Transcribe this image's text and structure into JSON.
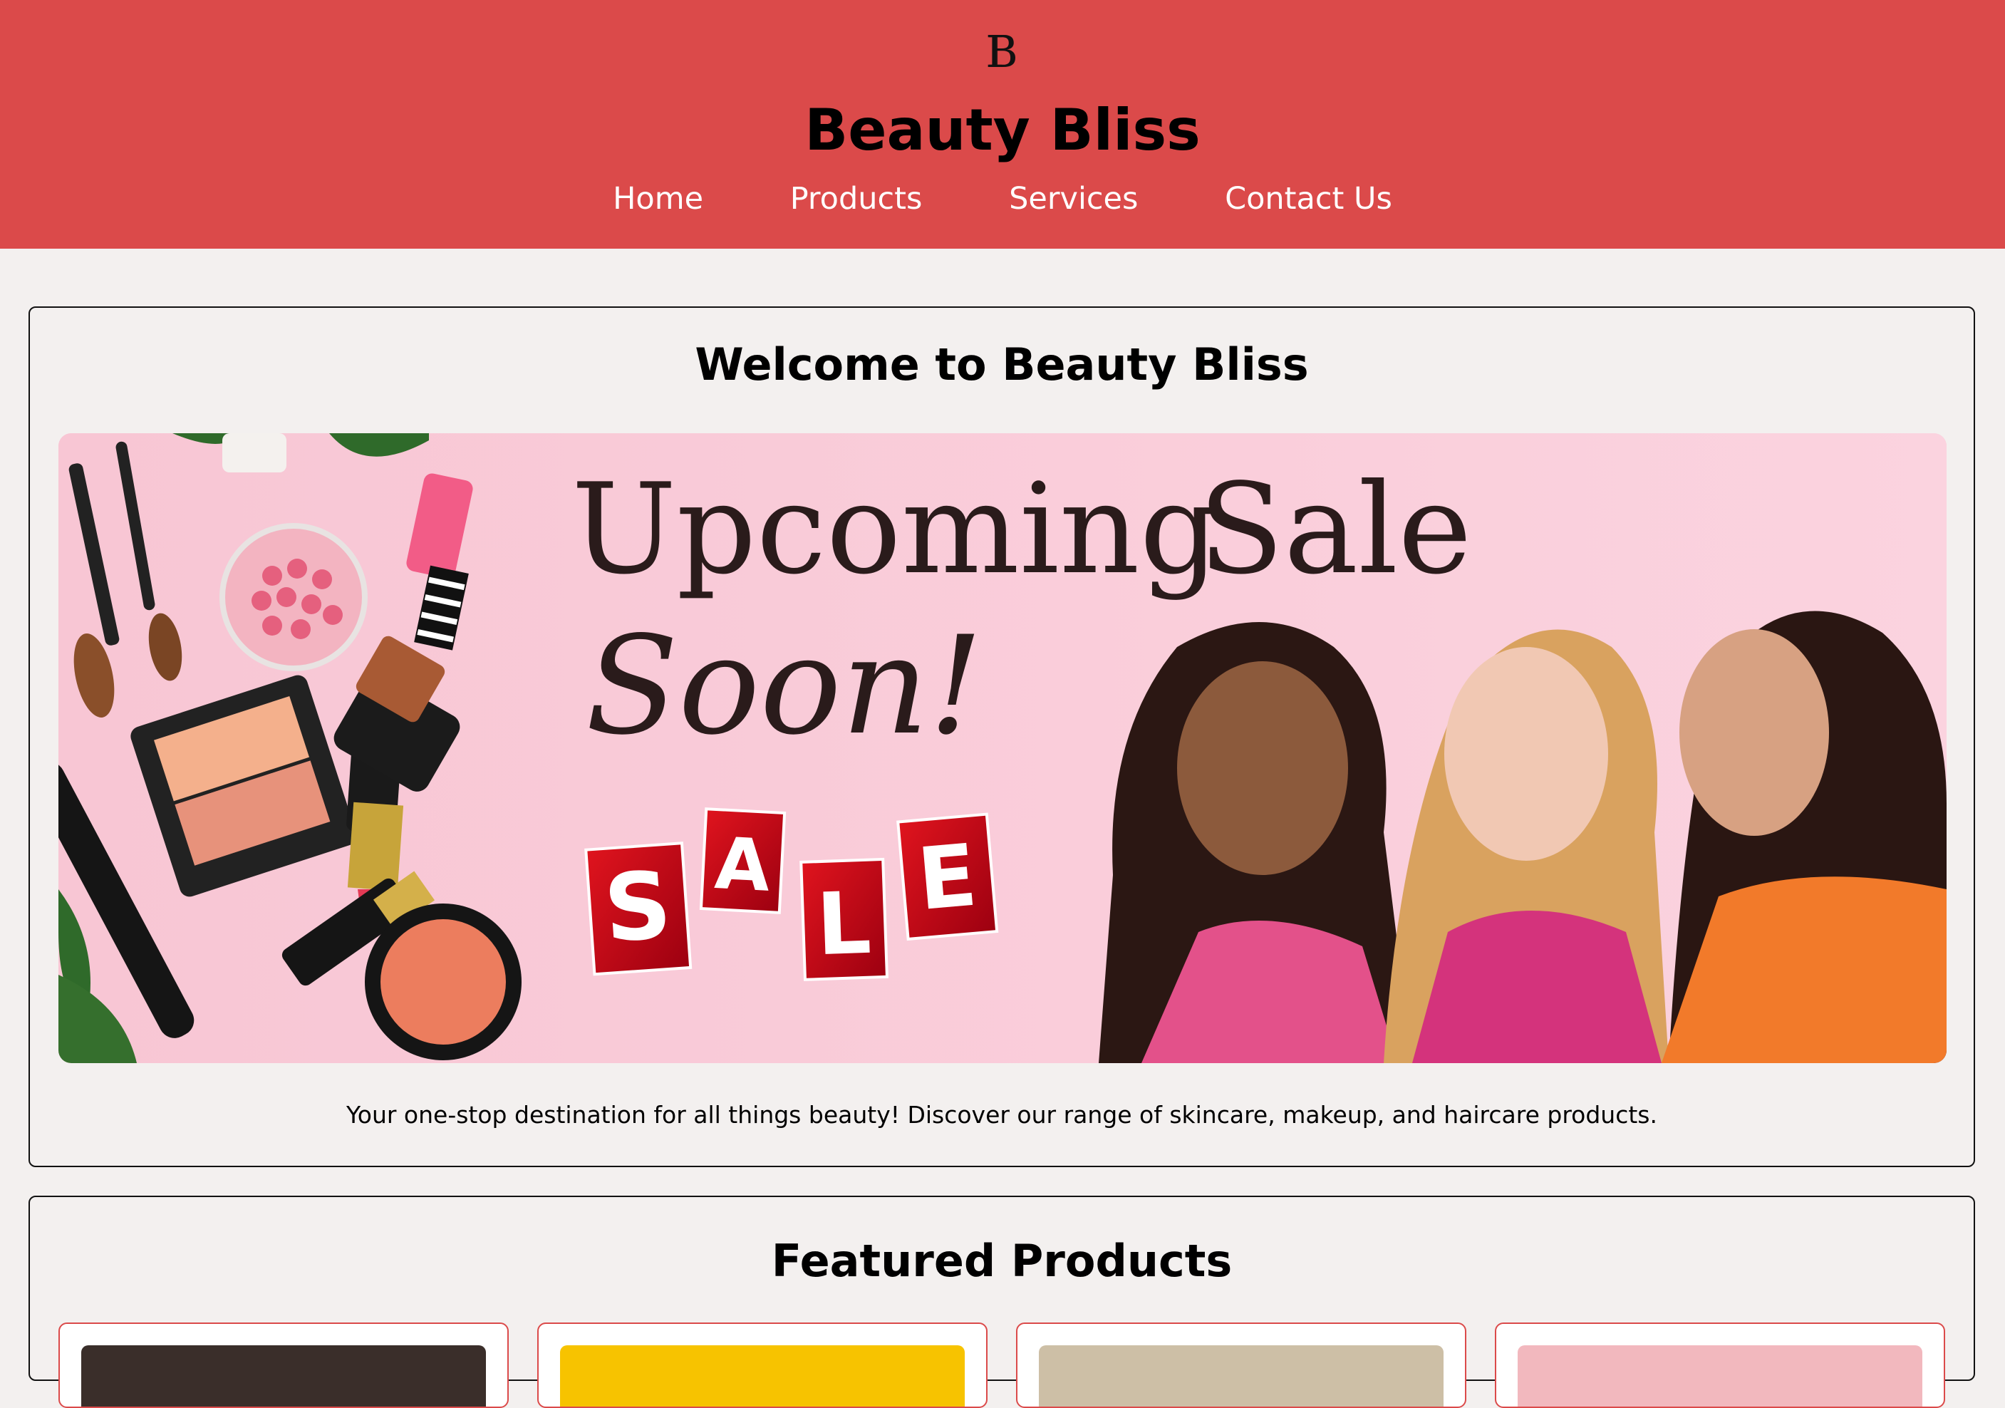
{
  "header": {
    "brand": "Beauty Bliss",
    "logo_icon": "bb-monogram-logo",
    "background": "#db4a4a",
    "nav": [
      "Home",
      "Products",
      "Services",
      "Contact Us"
    ]
  },
  "welcome": {
    "title": "Welcome to Beauty Bliss",
    "banner": {
      "line1": "Upcoming Sale",
      "line2": "Soon!",
      "tiles": [
        "S",
        "A",
        "L",
        "E"
      ],
      "background": "#f9c9d6"
    },
    "tagline": "Your one-stop destination for all things beauty! Discover our range of skincare, makeup, and haircare products."
  },
  "featured": {
    "title": "Featured Products",
    "products": [
      {
        "thumb_color": "#3a2e2a"
      },
      {
        "thumb_color": "#f7c300"
      },
      {
        "thumb_color": "#cdbfa6"
      },
      {
        "thumb_color": "#f2b8be"
      }
    ]
  }
}
